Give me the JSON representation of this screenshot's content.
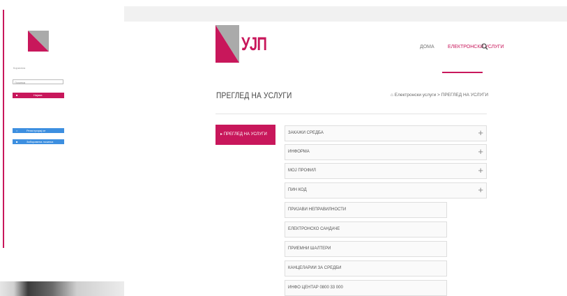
{
  "sidebar": {
    "username_label": "Корисник",
    "password_placeholder": "Лозинка",
    "login_label": "Најава",
    "register_label": "Регистрирај се",
    "forgot_label": "Заборавена лозинка"
  },
  "header": {
    "logo_text": "УЈП",
    "nav": {
      "home": "ДОМА",
      "services": "ЕЛЕКТРОНСКИ УСЛУГИ"
    }
  },
  "page": {
    "title": "ПРЕГЛЕД НА УСЛУГИ",
    "breadcrumb": {
      "home_icon": "home-icon",
      "root": "Електронски услуги",
      "separator": ">",
      "current": "ПРЕГЛЕД НА УСЛУГИ"
    }
  },
  "left_menu": {
    "active": "ПРЕГЛЕД НА УСЛУГИ"
  },
  "accordion": {
    "items": [
      {
        "label": "ЗАКАЖИ СРЕДБА"
      },
      {
        "label": "ИНФОРМА"
      },
      {
        "label": "МОЈ ПРОФИЛ"
      },
      {
        "label": "ПИН КОД"
      }
    ],
    "sub_items": [
      {
        "label": "ПРИЈАВИ НЕПРАВИЛНОСТИ"
      },
      {
        "label": "ЕЛЕКТРОНСКО САНДАЧЕ"
      },
      {
        "label": "ПРИЕМНИ ШАЛТЕРИ"
      },
      {
        "label": "КАНЦЕЛАРИИ ЗА СРЕДБИ"
      },
      {
        "label": "ИНФО ЦЕНТАР 0800 33 000"
      }
    ]
  },
  "colors": {
    "brand": "#c8175b",
    "accent_blue": "#3d8fe0",
    "logo_grey": "#aaaaaa"
  }
}
